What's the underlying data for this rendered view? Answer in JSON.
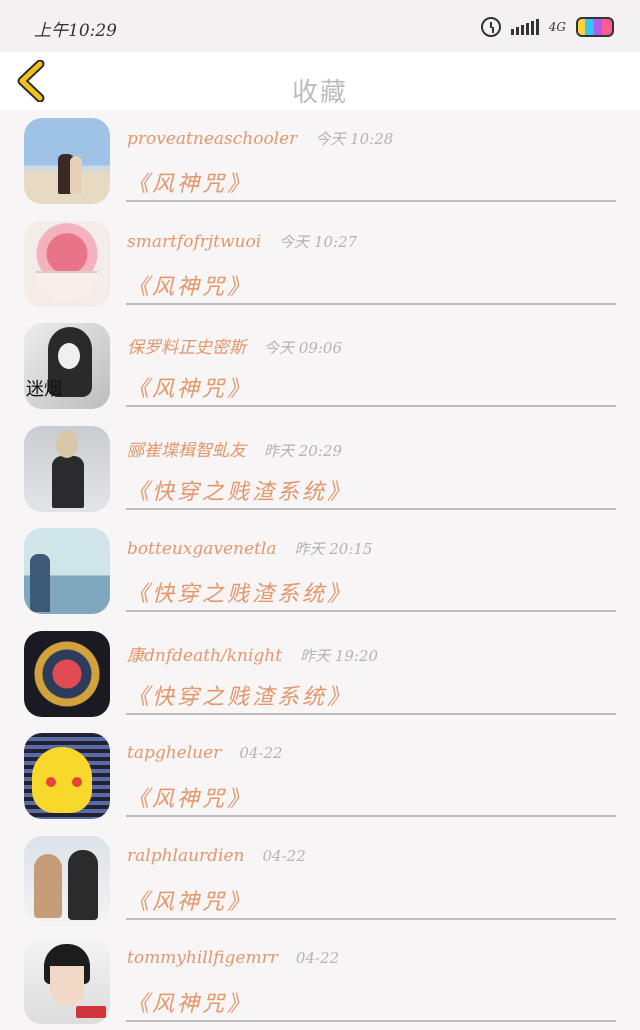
{
  "status_bar": {
    "time": "上午10:29",
    "network": "4G"
  },
  "nav": {
    "title": "收藏"
  },
  "items": [
    {
      "name": "proveatneaschooler",
      "time": "今天 10:28",
      "book": "《风神咒》",
      "avatar": "beach-couple-photo"
    },
    {
      "name": "smartfofrjtwuoi",
      "time": "今天 10:27",
      "book": "《风神咒》",
      "avatar": "rose-teacup-photo"
    },
    {
      "name": "保罗料正史密斯",
      "time": "今天 09:06",
      "book": "《风神咒》",
      "avatar": "girl-portrait-photo",
      "avatar_text": "迷烟"
    },
    {
      "name": "郦崔堞楫智虬友",
      "time": "昨天 20:29",
      "book": "《快穿之贱渣系统》",
      "avatar": "anime-boy-illustration"
    },
    {
      "name": "botteuxgavenetla",
      "time": "昨天 20:15",
      "book": "《快穿之贱渣系统》",
      "avatar": "sky-birds-illustration"
    },
    {
      "name": "康dnfdeath/knight",
      "time": "昨天 19:20",
      "book": "《快穿之贱渣系统》",
      "avatar": "colorful-artwork"
    },
    {
      "name": "tapgheluer",
      "time": "04-22",
      "book": "《风神咒》",
      "avatar": "pikachu-image"
    },
    {
      "name": "ralphlaurdien",
      "time": "04-22",
      "book": "《风神咒》",
      "avatar": "couple-photo"
    },
    {
      "name": "tommyhillfigemrr",
      "time": "04-22",
      "book": "《风神咒》",
      "avatar": "boy-selfie-photo"
    }
  ],
  "colors": {
    "accent": "#e4976b",
    "back_arrow": "#f2c21a",
    "title": "#bdbdbd"
  }
}
